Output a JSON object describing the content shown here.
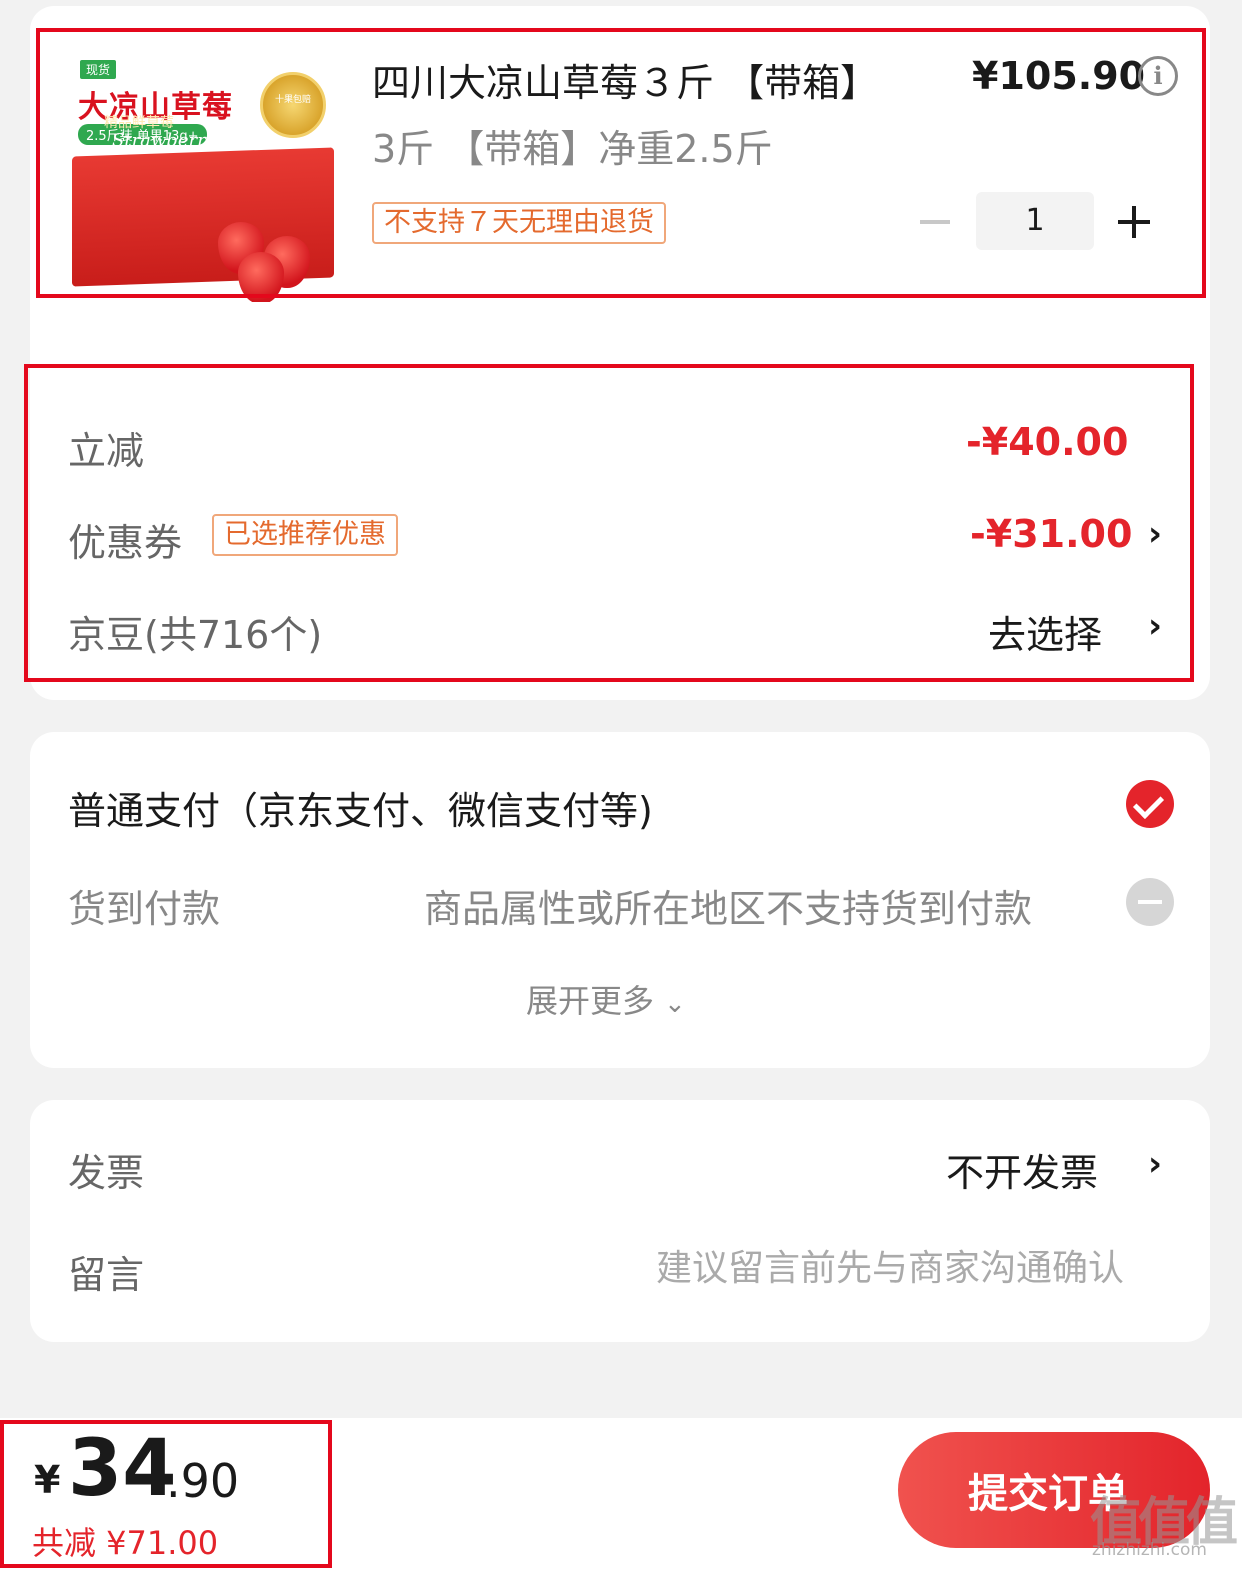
{
  "product": {
    "image": {
      "tag": "现货",
      "title": "大凉山草莓",
      "sub": "2.5斤装 单果13g+",
      "badge": "十果包赔",
      "box_text": "精品鲜草莓",
      "box_script": "Strawberry"
    },
    "title": "四川大凉山草莓３斤 【带箱】",
    "price": "¥105.90",
    "spec": "3斤 【带箱】净重2.5斤",
    "return_tag": "不支持７天无理由退货",
    "quantity": "1"
  },
  "discounts": {
    "instant": {
      "label": "立减",
      "amount": "-¥40.00"
    },
    "coupon": {
      "label": "优惠券",
      "tag": "已选推荐优惠",
      "amount": "-¥31.00"
    },
    "jingdou": {
      "label": "京豆(共716个)",
      "action": "去选择"
    }
  },
  "payment": {
    "normal": {
      "label": "普通支付（京东支付、微信支付等)",
      "selected": true
    },
    "cod": {
      "label": "货到付款",
      "note": "商品属性或所在地区不支持货到付款"
    },
    "expand_label": "展开更多"
  },
  "invoice": {
    "label": "发票",
    "value": "不开发票"
  },
  "message": {
    "label": "留言",
    "placeholder": "建议留言前先与商家沟通确认"
  },
  "footer": {
    "currency": "¥",
    "total_int": "34",
    "total_dec": ".90",
    "total_discount": "共减 ¥71.00",
    "submit_label": "提交订单"
  },
  "watermark": {
    "text": "值值值",
    "url": "zhizhizhi.com"
  },
  "colors": {
    "accent": "#e4242b",
    "highlight_box": "#e4081c",
    "tag_orange": "#e46a2e"
  },
  "icons": {
    "info": "info-icon",
    "chevron": "chevron-right-icon",
    "check": "check-circle-icon",
    "disabled": "minus-circle-icon"
  }
}
